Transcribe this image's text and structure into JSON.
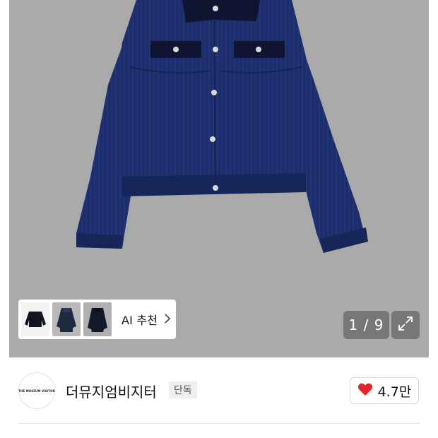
{
  "product_image": {
    "counter": "1 / 9",
    "icon": "expand-icon"
  },
  "ai_recommend": {
    "label": "AI 추천",
    "thumbnails": [
      "jacket-thumbnail-1",
      "jacket-thumbnail-2",
      "jacket-thumbnail-3"
    ],
    "icon": "chevron-right-icon"
  },
  "brand": {
    "logo_text": "THE MUSEUM VISITOR",
    "name": "더뮤지엄비지터",
    "badge": "단독"
  },
  "like": {
    "count": "4.7만",
    "icon": "heart-icon",
    "color": "#e8242a"
  },
  "colors": {
    "image_background": "#aaaaaa",
    "jacket": "#1a2a66",
    "collar": "#0f1530"
  }
}
